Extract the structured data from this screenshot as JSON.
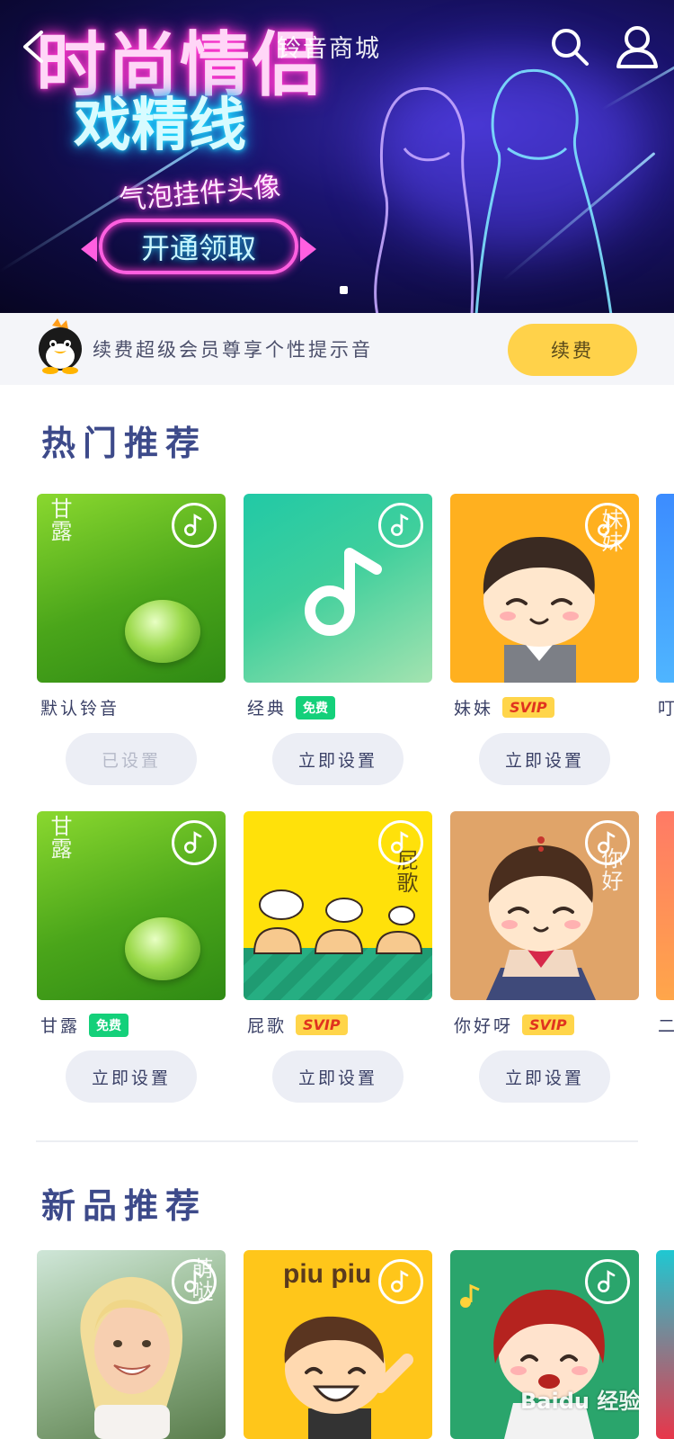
{
  "nav": {
    "title": "铃音商城"
  },
  "banner": {
    "headline": "时尚情侣",
    "subhead": "戏精线",
    "tagline": "气泡挂件头像",
    "cta": "开通领取",
    "page_indicator": 1
  },
  "vip_strip": {
    "text": "续费超级会员尊享个性提示音",
    "button": "续费"
  },
  "hot": {
    "title": "热门推荐",
    "items": [
      {
        "name": "默认铃音",
        "tag": "",
        "thumb_text": "甘露",
        "button": "已设置",
        "icon": "music-note-icon"
      },
      {
        "name": "经典",
        "tag": "免费",
        "thumb_text": "",
        "button": "立即设置",
        "icon": "music-note-icon"
      },
      {
        "name": "妹妹",
        "tag": "SVIP",
        "thumb_text": "妹妹",
        "button": "立即设置",
        "icon": "music-note-icon"
      },
      {
        "name": "甘露",
        "tag": "免费",
        "thumb_text": "甘露",
        "button": "立即设置",
        "icon": "music-note-icon"
      },
      {
        "name": "屁歌",
        "tag": "SVIP",
        "thumb_text": "屁歌",
        "button": "立即设置",
        "icon": "music-note-icon"
      },
      {
        "name": "你好呀",
        "tag": "SVIP",
        "thumb_text": "你好",
        "button": "立即设置",
        "icon": "music-note-icon"
      }
    ],
    "edge_labels": [
      "叮",
      "二"
    ]
  },
  "new": {
    "title": "新品推荐",
    "items": [
      {
        "thumb_text": "萌哒",
        "icon": "music-note-icon"
      },
      {
        "thumb_text": "piu piu",
        "icon": "music-note-icon"
      },
      {
        "thumb_text": "",
        "icon": "music-note-icon"
      }
    ]
  },
  "watermark": "Baidu 经验",
  "colors": {
    "accent_yellow": "#ffd24a",
    "free_green": "#14d07a",
    "svip_red": "#e0331f",
    "title_blue": "#3d4a8a"
  }
}
